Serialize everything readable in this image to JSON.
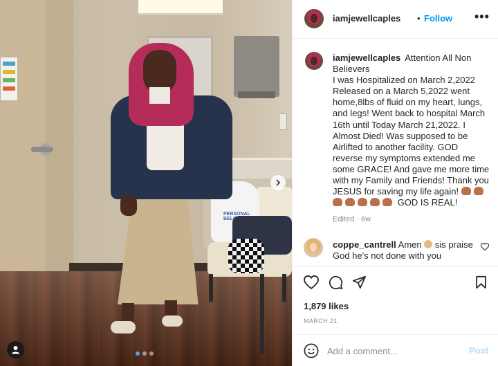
{
  "post": {
    "author": "iamjewellcaples",
    "separator": "•",
    "follow_label": "Follow",
    "more_label": "•••",
    "caption_lines": [
      "Attention All Non",
      "Believers",
      "I was Hospitalized on March 2,2022",
      "Released on a March 5,2022 went",
      "home,8lbs of fluid on my heart, lungs,",
      "and legs! Went back to hospital March",
      "16th until Today March 21,2022. I",
      "Almost Died! Was supposed to be",
      "Airlifted to another facility. GOD",
      "reverse my symptoms extended me",
      "some GRACE! And gave me more time",
      "with my Family and Friends! Thank you",
      "JESUS for saving my life again!"
    ],
    "caption_end": "GOD IS REAL!",
    "edited_label": "Edited · 6w"
  },
  "comment": {
    "user": "coppe_cantrell",
    "text_before_emoji": "Amen",
    "text_after_emoji": "sis praise God he's not done with you"
  },
  "engagement": {
    "likes": "1,879 likes",
    "date": "MARCH 21"
  },
  "add_comment": {
    "placeholder": "Add a comment...",
    "post_label": "Post"
  },
  "photo": {
    "bag_text": "PERSONAL BELONGINGS",
    "carousel_dots": 3,
    "active_dot": 0
  },
  "icons": {
    "more": "more-options-icon",
    "heart": "heart-icon",
    "comment": "comment-icon",
    "share": "share-icon",
    "save": "bookmark-icon",
    "emoji": "emoji-icon",
    "tag": "user-tag-icon",
    "next": "chevron-right-icon"
  },
  "colors": {
    "link_blue": "#0095f6",
    "post_disabled": "#b2dffc",
    "muted": "#8e8e8e",
    "text": "#262626"
  }
}
